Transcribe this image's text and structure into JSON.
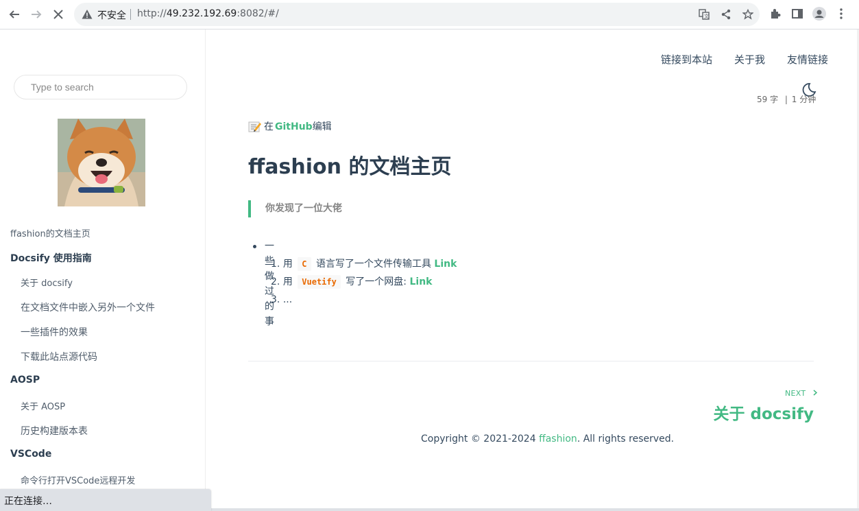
{
  "browser": {
    "security_label": "不安全",
    "url_prefix": "http://",
    "url_host": "49.232.192.69",
    "url_rest": ":8082/#/",
    "status_text": "正在连接…"
  },
  "search": {
    "placeholder": "Type to search"
  },
  "sidebar": {
    "items": [
      {
        "label": "ffashion的文档主页"
      },
      {
        "label": "Docsify 使用指南"
      },
      {
        "label": "关于 docsify"
      },
      {
        "label": "在文档文件中嵌入另外一个文件"
      },
      {
        "label": "一些插件的效果"
      },
      {
        "label": "下载此站点源代码"
      },
      {
        "label": "AOSP"
      },
      {
        "label": "关于 AOSP"
      },
      {
        "label": "历史构建版本表"
      },
      {
        "label": "VSCode"
      },
      {
        "label": "命令行打开VSCode远程开发"
      }
    ]
  },
  "topnav": {
    "links": [
      {
        "label": "链接到本站"
      },
      {
        "label": "关于我"
      },
      {
        "label": "友情链接"
      }
    ]
  },
  "meta": {
    "word_count": "59 字",
    "read_time": "1 分钟"
  },
  "edit": {
    "prefix": "在",
    "link": "GitHub",
    "suffix": "编辑"
  },
  "page": {
    "title": "ffashion 的文档主页",
    "quote": "你发现了一位大佬",
    "bullet": "一些做过的事",
    "items": [
      {
        "num": "1.",
        "pre": "用",
        "code": "C",
        "post": "语言写了一个文件传输工具",
        "link": "Link"
      },
      {
        "num": "2.",
        "pre": "用",
        "code": "Vuetify",
        "post": "写了一个网盘:",
        "link": "Link"
      },
      {
        "num": "3.",
        "text": "..."
      }
    ]
  },
  "pagination": {
    "next_label": "NEXT",
    "next_title": "关于 docsify"
  },
  "footer": {
    "prefix": "Copyright © 2021-2024 ",
    "link": "ffashion",
    "suffix": ". All rights reserved."
  },
  "colors": {
    "accent": "#42b983",
    "code": "#e96900",
    "text": "#34495e"
  }
}
